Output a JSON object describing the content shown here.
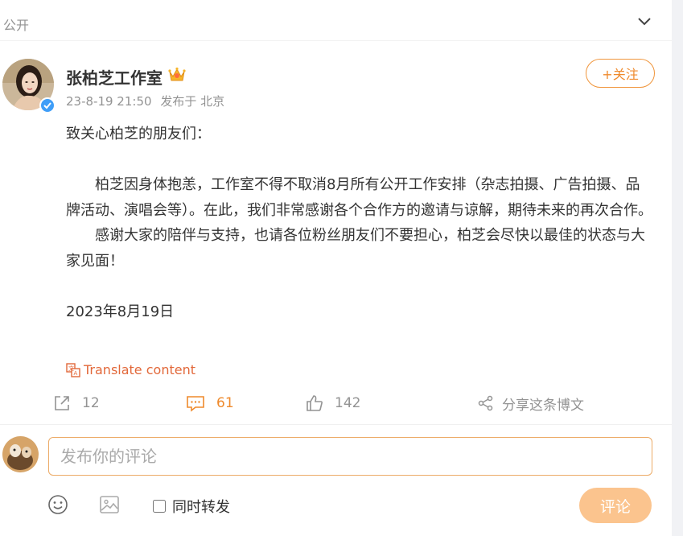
{
  "post": {
    "visibility": "公开",
    "author": {
      "name": "张柏芝工作室",
      "verified_badge": "blue-verified",
      "member_icon": "crown-icon"
    },
    "meta": {
      "date": "23-8-19 21:50",
      "location": "发布于 北京"
    },
    "follow_label": "+关注",
    "content": {
      "greeting": "致关心柏芝的朋友们：",
      "paragraph1": "柏芝因身体抱恙，工作室不得不取消8月所有公开工作安排（杂志拍摄、广告拍摄、品牌活动、演唱会等）。在此，我们非常感谢各个合作方的邀请与谅解，期待未来的再次合作。",
      "paragraph2": "感谢大家的陪伴与支持，也请各位粉丝朋友们不要担心，柏芝会尽快以最佳的状态与大家见面！",
      "date_line": "2023年8月19日"
    },
    "translate_label": "Translate content",
    "actions": {
      "repost_count": "12",
      "comment_count": "61",
      "like_count": "142",
      "share_label": "分享这条博文"
    }
  },
  "comment_box": {
    "placeholder": "发布你的评论",
    "repost_option_label": "同时转发",
    "submit_label": "评论"
  },
  "colors": {
    "accent": "#ef8a2c",
    "submit_disabled": "#fbc48e",
    "verified": "#3f9ef8",
    "muted_text": "#939393"
  }
}
